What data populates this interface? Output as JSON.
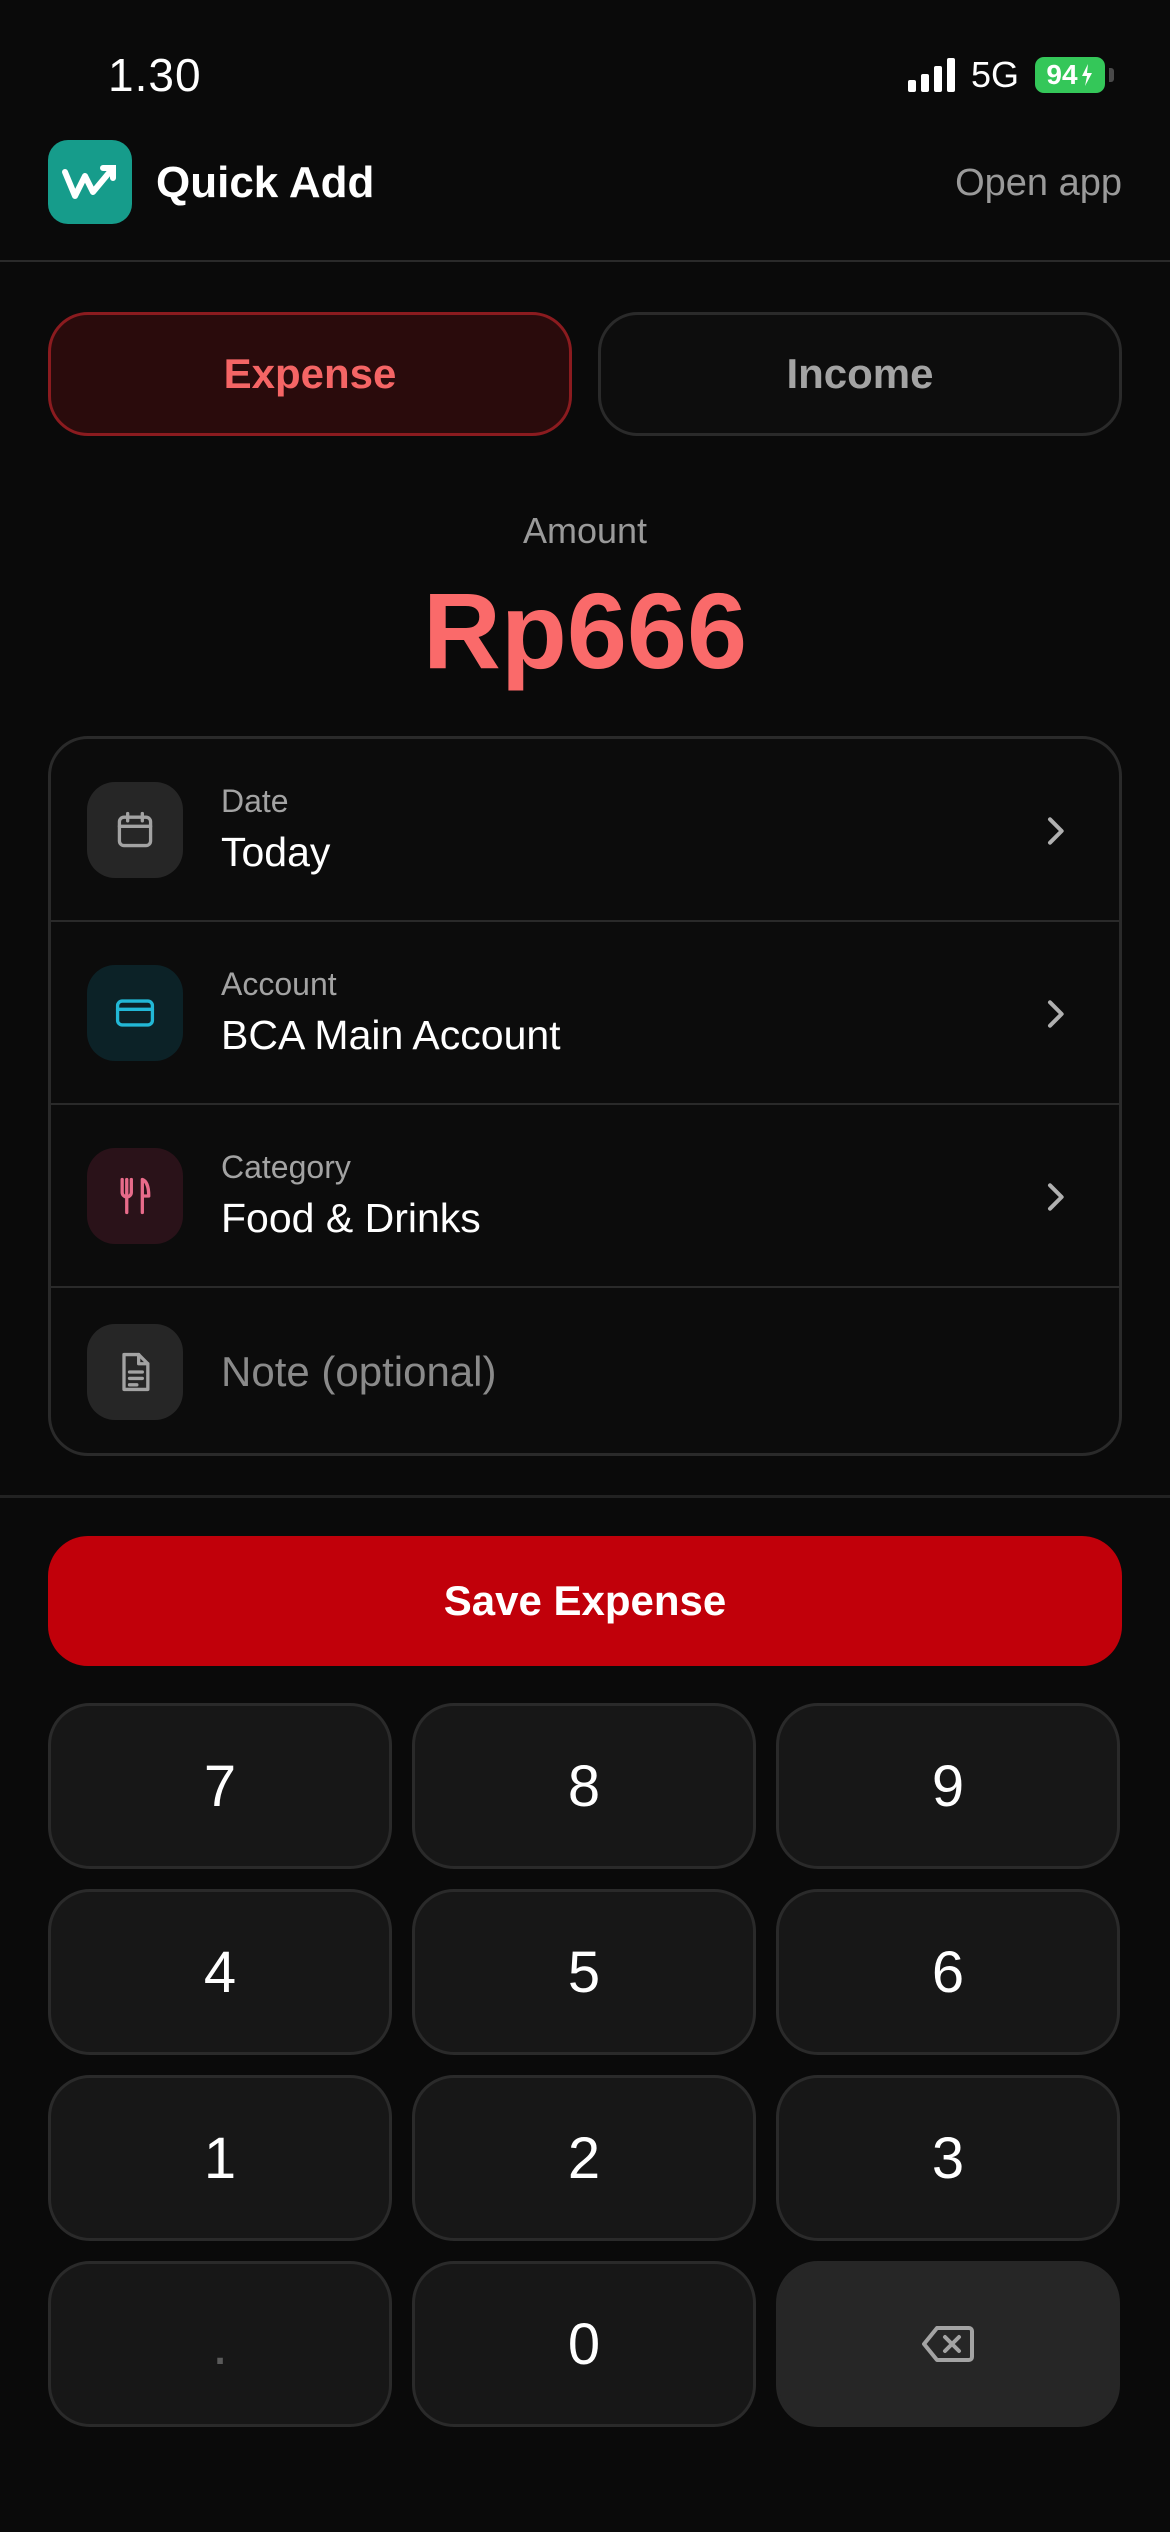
{
  "status_bar": {
    "time": "1.30",
    "network": "5G",
    "battery": "94"
  },
  "header": {
    "title": "Quick Add",
    "open_app": "Open app"
  },
  "type_toggle": {
    "expense": "Expense",
    "income": "Income"
  },
  "amount": {
    "label": "Amount",
    "value": "Rp666"
  },
  "fields": {
    "date": {
      "label": "Date",
      "value": "Today"
    },
    "account": {
      "label": "Account",
      "value": "BCA Main Account"
    },
    "category": {
      "label": "Category",
      "value": "Food & Drinks"
    },
    "note": {
      "placeholder": "Note (optional)"
    }
  },
  "save_button": "Save Expense",
  "keypad": {
    "k7": "7",
    "k8": "8",
    "k9": "9",
    "k4": "4",
    "k5": "5",
    "k6": "6",
    "k1": "1",
    "k2": "2",
    "k3": "3",
    "kdot": ".",
    "k0": "0",
    "backspace_icon": "backspace-icon"
  },
  "colors": {
    "background": "#0a0a0a",
    "expense_accent": "#fa6a6a",
    "save_button": "#c1000a",
    "app_logo": "#169c8b",
    "account_icon": "#22b8d6",
    "category_icon": "#e86b8a",
    "battery": "#34c759"
  }
}
